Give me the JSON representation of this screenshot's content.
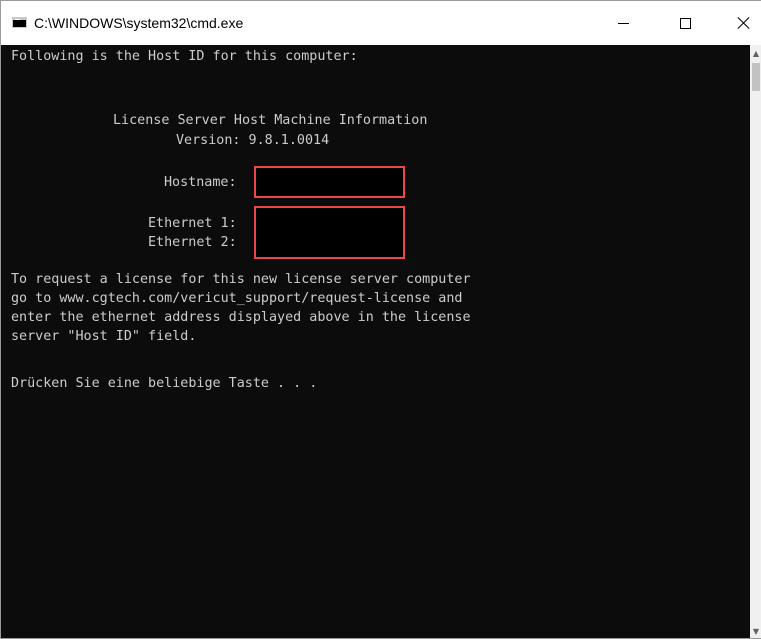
{
  "window": {
    "title": "C:\\WINDOWS\\system32\\cmd.exe",
    "icon": "cmd-icon",
    "controls": [
      "minimize-icon",
      "maximize-icon",
      "close-icon"
    ]
  },
  "console": {
    "text_color": "#cccccc",
    "background": "#0c0c0c",
    "lines": {
      "intro": "Following is the Host ID for this computer:",
      "header": "License Server Host Machine Information",
      "version": "Version: 9.8.1.0014",
      "hostname_label": "Hostname:",
      "ethernet1_label": "Ethernet 1:",
      "ethernet2_label": "Ethernet 2:",
      "request1": "To request a license for this new license server computer",
      "request2": "go to www.cgtech.com/vericut_support/request-license and",
      "request3": "enter the ethernet address displayed above in the license",
      "request4": "server \"Host ID\" field.",
      "prompt": "Drücken Sie eine beliebige Taste . . ."
    },
    "redaction_color": "#e8474c"
  }
}
